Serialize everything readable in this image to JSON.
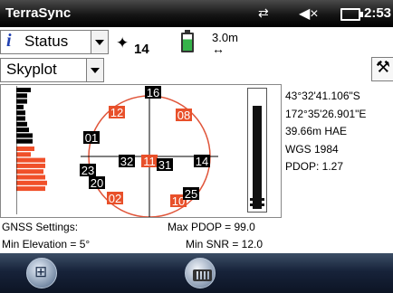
{
  "titlebar": {
    "app_title": "TerraSync",
    "time": "2:53",
    "icons": [
      "network-sync-icon",
      "volume-muted-icon",
      "battery-icon"
    ]
  },
  "toolbar": {
    "section_select": "Status",
    "info_icon": "i",
    "satellites_in_use": "14",
    "accuracy": "3.0m",
    "accuracy_arrow": "↔",
    "view_select": "Skyplot",
    "settings_icon": "wrench-icon"
  },
  "position": {
    "latitude": "43°32'41.106\"S",
    "longitude": "172°35'26.901\"E",
    "height": "39.66m HAE",
    "datum": "WGS 1984",
    "pdop": "PDOP: 1.27"
  },
  "gnss_settings": {
    "label": "GNSS Settings:",
    "max_pdop": "Max PDOP = 99.0",
    "min_elevation": "Min Elevation = 5°",
    "min_snr": "Min SNR = 12.0"
  },
  "skyplot": {
    "satellites": [
      {
        "id": "16",
        "used": true
      },
      {
        "id": "12",
        "used": false
      },
      {
        "id": "08",
        "used": false
      },
      {
        "id": "01",
        "used": true
      },
      {
        "id": "32",
        "used": true
      },
      {
        "id": "11",
        "used": false
      },
      {
        "id": "31",
        "used": true
      },
      {
        "id": "14",
        "used": true
      },
      {
        "id": "23",
        "used": true
      },
      {
        "id": "20",
        "used": true
      },
      {
        "id": "02",
        "used": false
      },
      {
        "id": "10",
        "used": false
      },
      {
        "id": "25",
        "used": true
      }
    ],
    "colors": {
      "used": "#000000",
      "unused": "#e8502a",
      "circle": "#e0553a"
    }
  },
  "signal_strength": {
    "black_bars": [
      16,
      12,
      12,
      8,
      10,
      10,
      12,
      14,
      18,
      18
    ],
    "red_bars": [
      20,
      16,
      32,
      32,
      30,
      32,
      34,
      32
    ]
  },
  "pdop_bar": {
    "level": 0.88
  },
  "taskbar": {
    "icons": [
      "windows-start-icon",
      "keyboard-icon"
    ]
  }
}
